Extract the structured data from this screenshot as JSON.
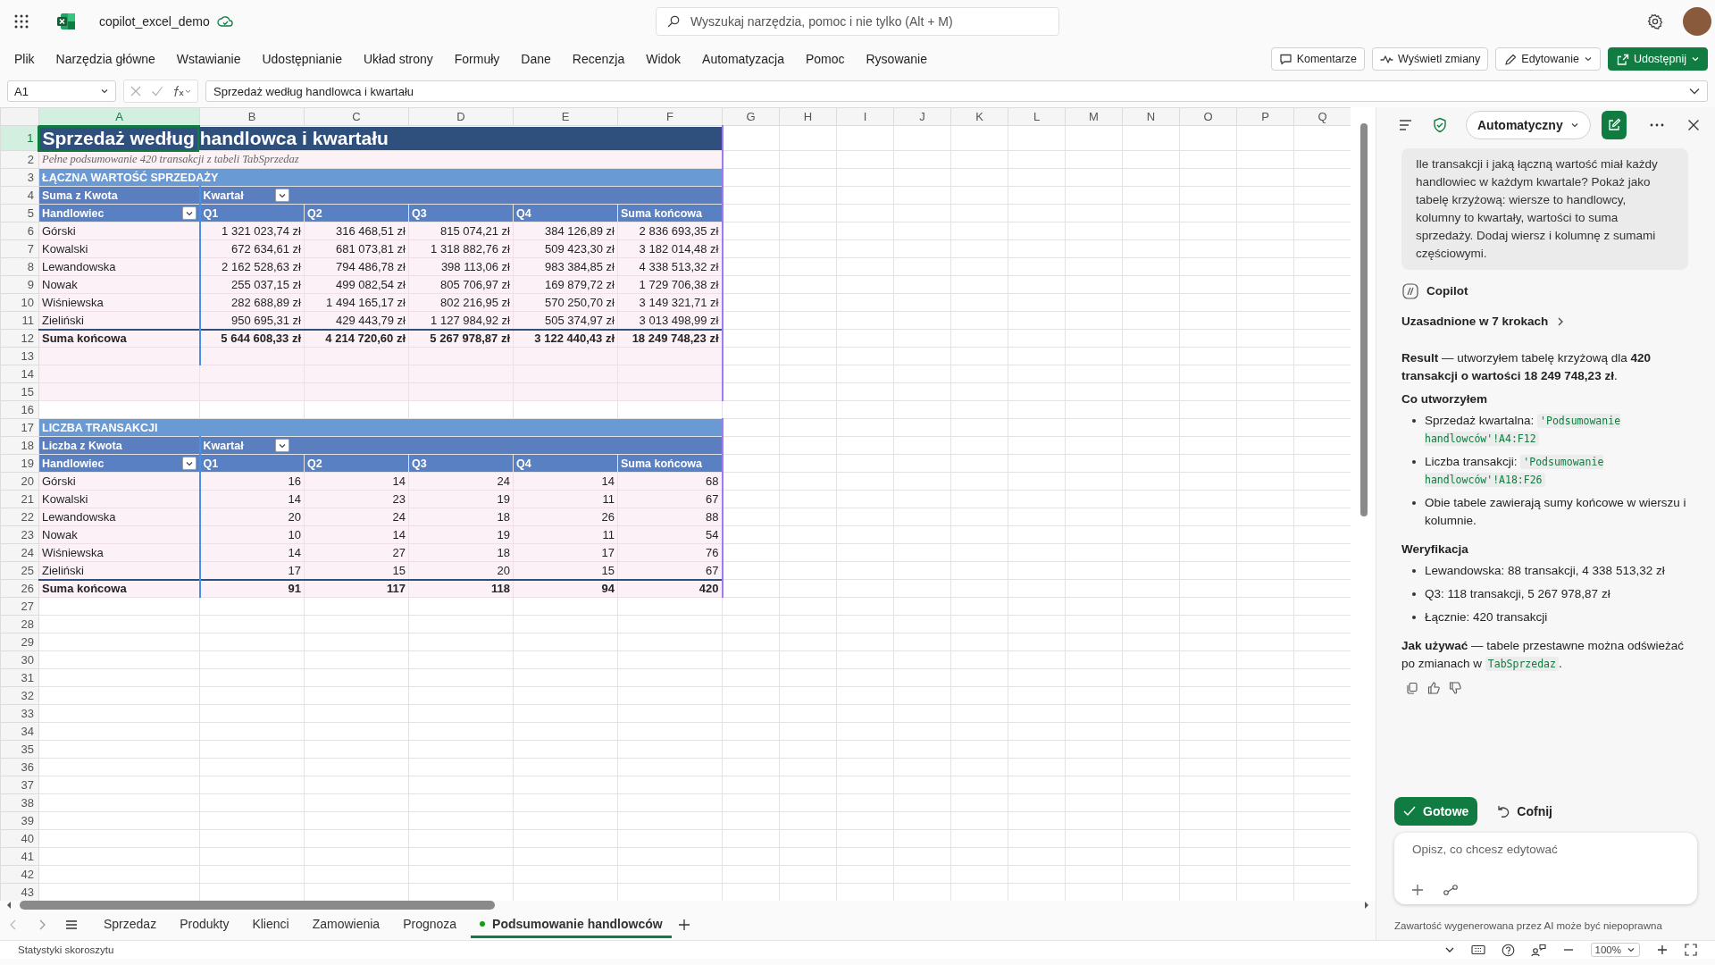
{
  "title_bar": {
    "file_name": "copilot_excel_demo",
    "search_placeholder": "Wyszukaj narzędzia, pomoc i nie tylko (Alt + M)"
  },
  "ribbon": {
    "tabs": [
      "Plik",
      "Narzędzia główne",
      "Wstawianie",
      "Udostępnianie",
      "Układ strony",
      "Formuły",
      "Dane",
      "Recenzja",
      "Widok",
      "Automatyzacja",
      "Pomoc",
      "Rysowanie"
    ],
    "actions": [
      {
        "label": "Komentarze",
        "kind": "comments"
      },
      {
        "label": "Wyświetl zmiany",
        "kind": "changes"
      },
      {
        "label": "Edytowanie",
        "kind": "editing"
      },
      {
        "label": "Udostępnij",
        "kind": "share"
      }
    ]
  },
  "formula_bar": {
    "name_box": "A1",
    "formula": "Sprzedaż według handlowca i kwartału"
  },
  "sheet": {
    "columns": [
      {
        "label": "A",
        "selected": true
      },
      {
        "label": "B",
        "selected": false
      },
      {
        "label": "C",
        "selected": false
      },
      {
        "label": "D",
        "selected": false
      },
      {
        "label": "E",
        "selected": false
      },
      {
        "label": "F",
        "selected": false
      },
      {
        "label": "G",
        "selected": false
      },
      {
        "label": "H",
        "selected": false
      },
      {
        "label": "I",
        "selected": false
      },
      {
        "label": "J",
        "selected": false
      },
      {
        "label": "K",
        "selected": false
      },
      {
        "label": "L",
        "selected": false
      },
      {
        "label": "M",
        "selected": false
      },
      {
        "label": "N",
        "selected": false
      },
      {
        "label": "O",
        "selected": false
      },
      {
        "label": "P",
        "selected": false
      },
      {
        "label": "Q",
        "selected": false
      }
    ],
    "rows": [
      {
        "label": "1",
        "selected": true
      },
      {
        "label": "2",
        "selected": false
      },
      {
        "label": "3",
        "selected": false
      },
      {
        "label": "4",
        "selected": false
      },
      {
        "label": "5",
        "selected": false
      },
      {
        "label": "6",
        "selected": false
      },
      {
        "label": "7",
        "selected": false
      },
      {
        "label": "8",
        "selected": false
      },
      {
        "label": "9",
        "selected": false
      },
      {
        "label": "10",
        "selected": false
      },
      {
        "label": "11",
        "selected": false
      },
      {
        "label": "12",
        "selected": false
      },
      {
        "label": "13",
        "selected": false
      },
      {
        "label": "14",
        "selected": false
      },
      {
        "label": "15",
        "selected": false
      },
      {
        "label": "16",
        "selected": false
      },
      {
        "label": "17",
        "selected": false
      },
      {
        "label": "18",
        "selected": false
      },
      {
        "label": "19",
        "selected": false
      },
      {
        "label": "20",
        "selected": false
      },
      {
        "label": "21",
        "selected": false
      },
      {
        "label": "22",
        "selected": false
      },
      {
        "label": "23",
        "selected": false
      },
      {
        "label": "24",
        "selected": false
      },
      {
        "label": "25",
        "selected": false
      },
      {
        "label": "26",
        "selected": false
      },
      {
        "label": "27",
        "selected": false
      },
      {
        "label": "28",
        "selected": false
      },
      {
        "label": "29",
        "selected": false
      },
      {
        "label": "30",
        "selected": false
      },
      {
        "label": "31",
        "selected": false
      },
      {
        "label": "32",
        "selected": false
      },
      {
        "label": "33",
        "selected": false
      },
      {
        "label": "34",
        "selected": false
      },
      {
        "label": "35",
        "selected": false
      },
      {
        "label": "36",
        "selected": false
      },
      {
        "label": "37",
        "selected": false
      },
      {
        "label": "38",
        "selected": false
      },
      {
        "label": "39",
        "selected": false
      },
      {
        "label": "40",
        "selected": false
      },
      {
        "label": "41",
        "selected": false
      },
      {
        "label": "42",
        "selected": false
      },
      {
        "label": "43",
        "selected": false
      }
    ],
    "title": "Sprzedaż według handlowca i kwartału",
    "subtitle": "Pełne podsumowanie 420 transakcji z tabeli TabSprzedaz",
    "pivots": [
      {
        "section_title": "ŁĄCZNA WARTOŚĆ SPRZEDAŻY",
        "value_field": "Suma z Kwota",
        "column_field": "Kwartał",
        "row_field": "Handlowiec",
        "columns": [
          "Q1",
          "Q2",
          "Q3",
          "Q4",
          "Suma końcowa"
        ],
        "rows": [
          {
            "name": "Górski",
            "values": [
              "1 321 023,74 zł",
              "316 468,51 zł",
              "815 074,21 zł",
              "384 126,89 zł",
              "2 836 693,35 zł"
            ]
          },
          {
            "name": "Kowalski",
            "values": [
              "672 634,61 zł",
              "681 073,81 zł",
              "1 318 882,76 zł",
              "509 423,30 zł",
              "3 182 014,48 zł"
            ]
          },
          {
            "name": "Lewandowska",
            "values": [
              "2 162 528,63 zł",
              "794 486,78 zł",
              "398 113,06 zł",
              "983 384,85 zł",
              "4 338 513,32 zł"
            ]
          },
          {
            "name": "Nowak",
            "values": [
              "255 037,15 zł",
              "499 082,54 zł",
              "805 706,97 zł",
              "169 879,72 zł",
              "1 729 706,38 zł"
            ]
          },
          {
            "name": "Wiśniewska",
            "values": [
              "282 688,89 zł",
              "1 494 165,17 zł",
              "802 216,95 zł",
              "570 250,70 zł",
              "3 149 321,71 zł"
            ]
          },
          {
            "name": "Zieliński",
            "values": [
              "950 695,31 zł",
              "429 443,79 zł",
              "1 127 984,92 zł",
              "505 374,97 zł",
              "3 013 498,99 zł"
            ]
          }
        ],
        "total": {
          "name": "Suma końcowa",
          "values": [
            "5 644 608,33 zł",
            "4 214 720,60 zł",
            "5 267 978,87 zł",
            "3 122 440,43 zł",
            "18 249 748,23 zł"
          ]
        }
      },
      {
        "section_title": "LICZBA TRANSAKCJI",
        "value_field": "Liczba z Kwota",
        "column_field": "Kwartał",
        "row_field": "Handlowiec",
        "columns": [
          "Q1",
          "Q2",
          "Q3",
          "Q4",
          "Suma końcowa"
        ],
        "rows": [
          {
            "name": "Górski",
            "values": [
              "16",
              "14",
              "24",
              "14",
              "68"
            ]
          },
          {
            "name": "Kowalski",
            "values": [
              "14",
              "23",
              "19",
              "11",
              "67"
            ]
          },
          {
            "name": "Lewandowska",
            "values": [
              "20",
              "24",
              "18",
              "26",
              "88"
            ]
          },
          {
            "name": "Nowak",
            "values": [
              "10",
              "14",
              "19",
              "11",
              "54"
            ]
          },
          {
            "name": "Wiśniewska",
            "values": [
              "14",
              "27",
              "18",
              "17",
              "76"
            ]
          },
          {
            "name": "Zieliński",
            "values": [
              "17",
              "15",
              "20",
              "15",
              "67"
            ]
          }
        ],
        "total": {
          "name": "Suma końcowa",
          "values": [
            "91",
            "117",
            "118",
            "94",
            "420"
          ]
        }
      }
    ]
  },
  "sheet_tabs": [
    {
      "label": "Sprzedaz",
      "selected": false,
      "modified": false
    },
    {
      "label": "Produkty",
      "selected": false,
      "modified": false
    },
    {
      "label": "Klienci",
      "selected": false,
      "modified": false
    },
    {
      "label": "Zamowienia",
      "selected": false,
      "modified": false
    },
    {
      "label": "Prognoza",
      "selected": false,
      "modified": false
    },
    {
      "label": "Podsumowanie handlowców",
      "selected": true,
      "modified": true
    }
  ],
  "status_bar": {
    "label": "Statystyki skoroszytu",
    "zoom": "100%"
  },
  "copilot": {
    "mode": "Automatyczny",
    "user_message": "Ile transakcji i jaką łączną wartość miał każdy handlowiec w każdym kwartale? Pokaż jako tabelę krzyżową: wiersze to handlowcy, kolumny to kwartały, wartości to suma sprzedaży. Dodaj wiersz i kolumnę z sumami częściowymi.",
    "assistant_name": "Copilot",
    "steps_link": "Uzasadnione w 7 krokach",
    "summary": "**Result** — utworzyłem tabelę krzyżową dla **420 transakcji o wartości 18 249 748,23 zł**.",
    "sections": [
      {
        "heading": "Co utworzyłem",
        "items": [
          {
            "text": "Sprzedaż kwartalna: ",
            "code": "'Podsumowanie handlowców'!A4:F12"
          },
          {
            "text": "Liczba transakcji: ",
            "code": "'Podsumowanie handlowców'!A18:F26"
          },
          {
            "text": "Obie tabele zawierają sumy końcowe w wierszu i kolumnie."
          }
        ]
      },
      {
        "heading": "Weryfikacja",
        "items": [
          {
            "text": "Lewandowska: 88 transakcji, 4 338 513,32 zł"
          },
          {
            "text": "Q3: 118 transakcji, 5 267 978,87 zł"
          },
          {
            "text": "Łącznie: 420 transakcji"
          }
        ]
      }
    ],
    "usage": {
      "text": "**Jak używać** — tabele przestawne można odświeżać po zmianach w ",
      "code": "TabSprzedaz",
      "after": "."
    },
    "done_button": "Gotowe",
    "undo_button": "Cofnij",
    "input_placeholder": "Opisz, co chcesz edytować",
    "disclaimer": "Zawartość wygenerowana przez AI może być niepoprawna"
  }
}
